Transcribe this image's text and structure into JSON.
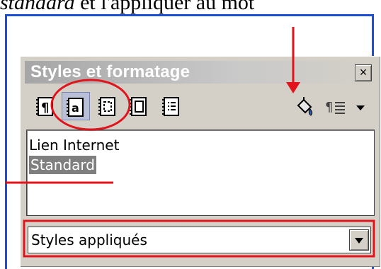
{
  "caption": {
    "italic": "standard",
    "rest": " et l'appliquer au mot"
  },
  "panel": {
    "title": "Styles et formatage",
    "close_label": "×",
    "toolbar": {
      "tools": [
        {
          "name": "paragraph-styles-icon",
          "active": false
        },
        {
          "name": "character-styles-icon",
          "active": true
        },
        {
          "name": "frame-styles-icon",
          "active": false
        },
        {
          "name": "page-styles-icon",
          "active": false
        },
        {
          "name": "list-styles-icon",
          "active": false
        }
      ],
      "fill_format_icon": "fill-format-mode-icon",
      "new_style_icon": "new-style-from-selection-icon"
    },
    "list_items": [
      "Lien Internet",
      "Standard"
    ],
    "selected_item": "Standard",
    "filter_value": "Styles appliqués"
  },
  "colors": {
    "annotation_red": "#e3131b",
    "frame_blue": "#1a4fd6",
    "selection_gray": "#7f7f7f"
  }
}
